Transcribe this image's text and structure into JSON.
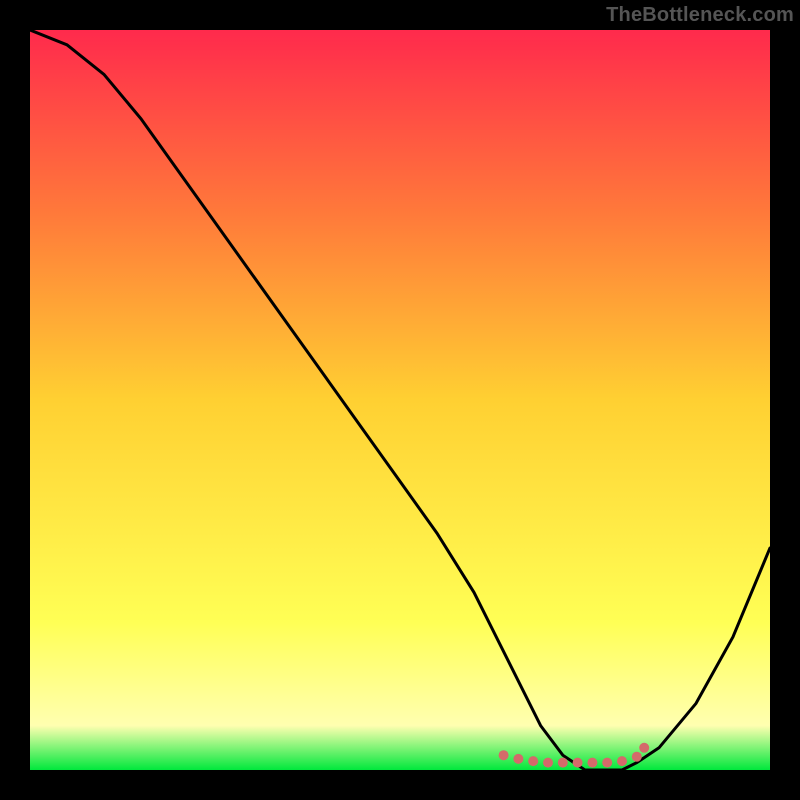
{
  "watermark": "TheBottleneck.com",
  "chart_data": {
    "type": "line",
    "title": "",
    "xlabel": "",
    "ylabel": "",
    "xlim": [
      0,
      100
    ],
    "ylim": [
      0,
      100
    ],
    "background_gradient": {
      "top": "#ff2a4c",
      "mid_upper": "#ff7a3a",
      "mid": "#ffd032",
      "mid_lower": "#ffff55",
      "band": "#ffffb0",
      "bottom": "#00e83c"
    },
    "series": [
      {
        "name": "bottleneck-curve",
        "stroke": "#000000",
        "x": [
          0,
          5,
          10,
          15,
          20,
          25,
          30,
          35,
          40,
          45,
          50,
          55,
          60,
          63,
          66,
          69,
          72,
          75,
          78,
          80,
          82,
          85,
          90,
          95,
          100
        ],
        "y": [
          100,
          98,
          94,
          88,
          81,
          74,
          67,
          60,
          53,
          46,
          39,
          32,
          24,
          18,
          12,
          6,
          2,
          0,
          0,
          0,
          1,
          3,
          9,
          18,
          30
        ]
      }
    ],
    "markers": {
      "name": "optimal-range-dots",
      "fill": "#d46a6a",
      "x": [
        64,
        66,
        68,
        70,
        72,
        74,
        76,
        78,
        80,
        82,
        83
      ],
      "y": [
        2,
        1.5,
        1.2,
        1,
        1,
        1,
        1,
        1,
        1.2,
        1.8,
        3
      ]
    }
  }
}
